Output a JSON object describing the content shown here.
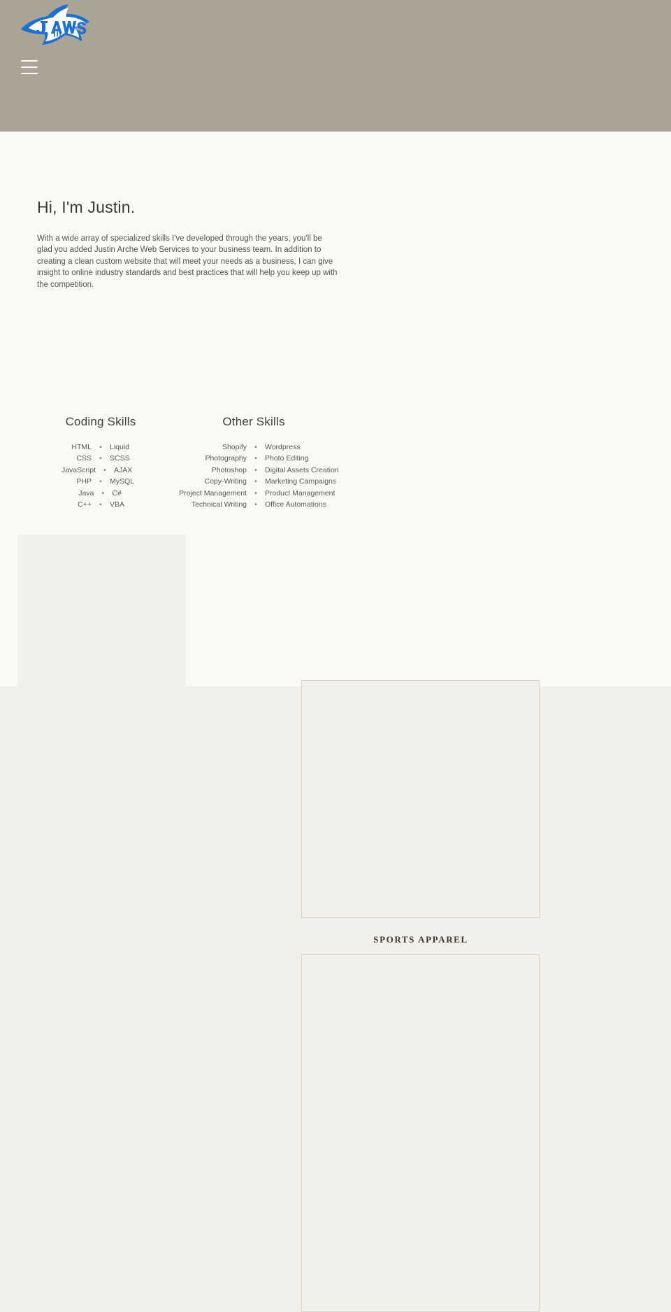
{
  "header": {
    "logo_alt": "JAWS",
    "logo_word": "JAWS",
    "menu_label": "Menu",
    "background_color": "#aba496",
    "logo_blue": "#1f6fd0",
    "logo_white": "#ffffff"
  },
  "intro": {
    "title": "Hi, I'm Justin.",
    "paragraph": "With a wide array of specialized skills I've developed through the years, you'll be glad you added Justin Arche Web Services to your business team. In addition to creating a clean custom website that will meet your needs as a business, I can give insight to online industry standards and best practices that will help you keep up with the competition."
  },
  "skills": {
    "coding": {
      "heading": "Coding Skills",
      "separator": "•",
      "rows": [
        {
          "left": "HTML",
          "right": "Liquid"
        },
        {
          "left": "CSS",
          "right": "SCSS"
        },
        {
          "left": "JavaScript",
          "right": "AJAX"
        },
        {
          "left": "PHP",
          "right": "MySQL"
        },
        {
          "left": "Java",
          "right": "C#"
        },
        {
          "left": "C++",
          "right": "VBA"
        }
      ]
    },
    "other": {
      "heading": "Other Skills",
      "separator": "•",
      "rows": [
        {
          "left": "Shopify",
          "right": "Wordpress"
        },
        {
          "left": "Photography",
          "right": "Photo Editing"
        },
        {
          "left": "Photoshop",
          "right": "Digital Assets Creation"
        },
        {
          "left": "Copy-Writing",
          "right": "Marketing Campaigns"
        },
        {
          "left": "Project Management",
          "right": "Product Management"
        },
        {
          "left": "Technical Writing",
          "right": "Office Automations"
        }
      ]
    }
  },
  "work": {
    "caption": "SPORTS APPAREL"
  },
  "colors": {
    "page_background": "#faf9f6",
    "section_background": "#f2f0ea",
    "header_background": "#aba496",
    "text_primary": "#3a3a38",
    "text_body": "#55544f"
  }
}
